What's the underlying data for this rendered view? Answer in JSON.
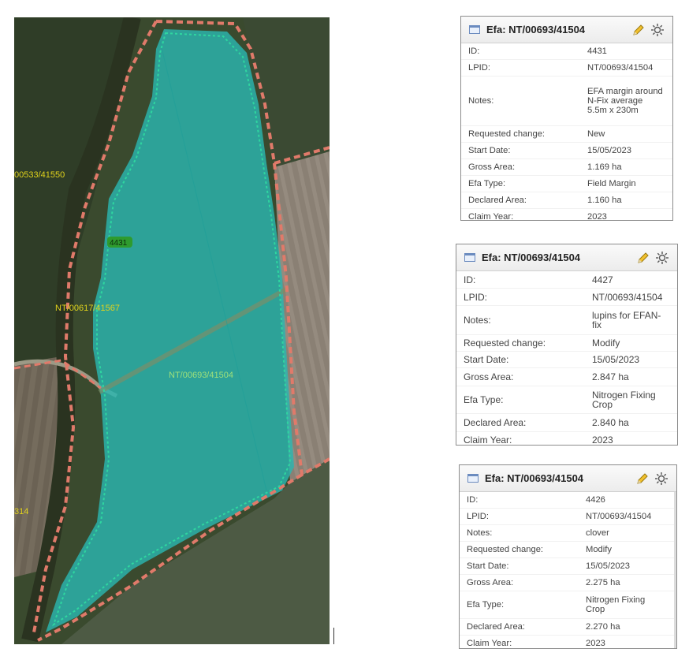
{
  "map": {
    "labels": {
      "parcel_41550": "00533/41550",
      "id_badge": "4431",
      "parcel_41567": "NT/00617/41567",
      "parcel_41504": "NT/00693/41504",
      "parcel_314": "314"
    },
    "colors": {
      "field_fill": "#2bb6b0",
      "parcel_boundary": "#e07a6a",
      "efa_outline": "#2fd6a0",
      "label_yellow": "#e0d21c",
      "label_green": "#9ee07a",
      "badge_bg": "#2e9b2e"
    }
  },
  "panels": [
    {
      "title": "Efa: NT/00693/41504",
      "rows": [
        {
          "key": "ID:",
          "value": "4431"
        },
        {
          "key": "LPID:",
          "value": "NT/00693/41504"
        },
        {
          "key": "Notes:",
          "value": "EFA margin around N-Fix average 5.5m x 230m"
        },
        {
          "key": "Requested change:",
          "value": "New"
        },
        {
          "key": "Start Date:",
          "value": "15/05/2023"
        },
        {
          "key": "Gross Area:",
          "value": "1.169 ha"
        },
        {
          "key": "Efa Type:",
          "value": "Field Margin"
        },
        {
          "key": "Declared Area:",
          "value": "1.160 ha"
        },
        {
          "key": "Claim Year:",
          "value": "2023"
        }
      ]
    },
    {
      "title": "Efa: NT/00693/41504",
      "rows": [
        {
          "key": "ID:",
          "value": "4427"
        },
        {
          "key": "LPID:",
          "value": "NT/00693/41504"
        },
        {
          "key": "Notes:",
          "value": "lupins for EFAN-fix"
        },
        {
          "key": "Requested change:",
          "value": "Modify"
        },
        {
          "key": "Start Date:",
          "value": "15/05/2023"
        },
        {
          "key": "Gross Area:",
          "value": "2.847 ha"
        },
        {
          "key": "Efa Type:",
          "value": "Nitrogen Fixing Crop"
        },
        {
          "key": "Declared Area:",
          "value": "2.840 ha"
        },
        {
          "key": "Claim Year:",
          "value": "2023"
        }
      ]
    },
    {
      "title": "Efa: NT/00693/41504",
      "rows": [
        {
          "key": "ID:",
          "value": "4426"
        },
        {
          "key": "LPID:",
          "value": "NT/00693/41504"
        },
        {
          "key": "Notes:",
          "value": "clover"
        },
        {
          "key": "Requested change:",
          "value": "Modify"
        },
        {
          "key": "Start Date:",
          "value": "15/05/2023"
        },
        {
          "key": "Gross Area:",
          "value": "2.275 ha"
        },
        {
          "key": "Efa Type:",
          "value": "Nitrogen Fixing Crop"
        },
        {
          "key": "Declared Area:",
          "value": "2.270 ha"
        },
        {
          "key": "Claim Year:",
          "value": "2023"
        }
      ]
    }
  ]
}
